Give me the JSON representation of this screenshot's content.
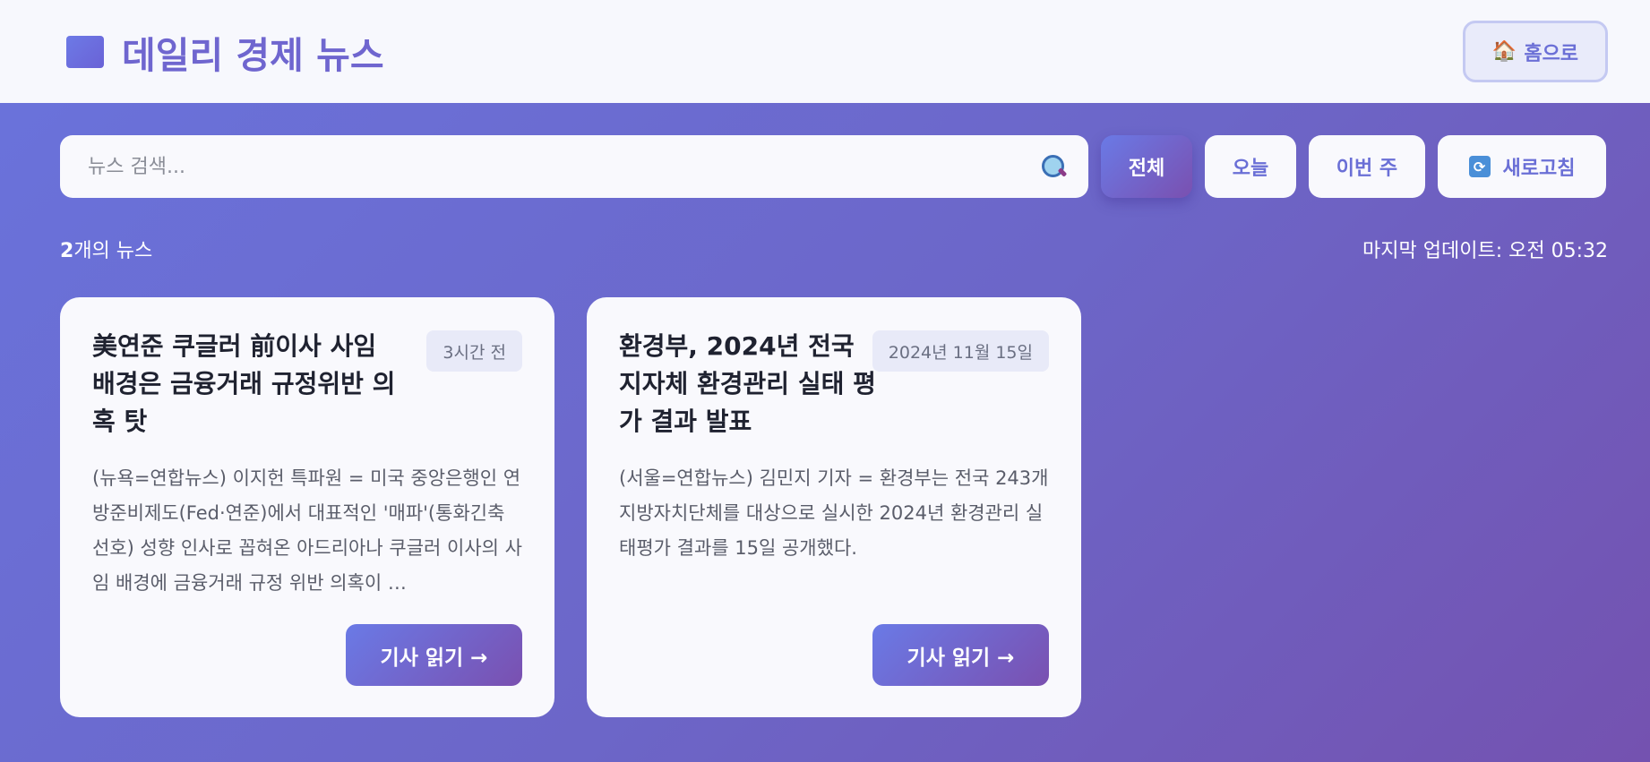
{
  "header": {
    "title": "데일리 경제 뉴스",
    "home_label": "홈으로",
    "home_emoji": "🏠"
  },
  "toolbar": {
    "search_placeholder": "뉴스 검색...",
    "filters": [
      {
        "label": "전체",
        "active": true
      },
      {
        "label": "오늘",
        "active": false
      },
      {
        "label": "이번 주",
        "active": false
      }
    ],
    "refresh_label": "새로고침",
    "refresh_icon": "🔄"
  },
  "meta": {
    "count": "2",
    "count_suffix": "개의 뉴스",
    "last_update": "마지막 업데이트: 오전 05:32"
  },
  "articles": [
    {
      "title": "美연준 쿠글러 前이사 사임 배경은 금융거래 규정위반 의혹 탓",
      "date": "3시간 전",
      "summary": "(뉴욕=연합뉴스) 이지헌 특파원 = 미국 중앙은행인 연방준비제도(Fed·연준)에서 대표적인 '매파'(통화긴축 선호) 성향 인사로 꼽혀온 아드리아나 쿠글러 이사의 사임 배경에 금융거래 규정 위반 의혹이 …",
      "read_label": "기사 읽기 →"
    },
    {
      "title": "환경부, 2024년 전국 지자체 환경관리 실태 평가 결과 발표",
      "date": "2024년 11월 15일",
      "summary": "(서울=연합뉴스) 김민지 기자 = 환경부는 전국 243개 지방자치단체를 대상으로 실시한 2024년 환경관리 실태평가 결과를 15일 공개했다.",
      "read_label": "기사 읽기 →"
    }
  ],
  "colors": {
    "accent": "#6a6fd6",
    "gradient_start": "#6a7ae6",
    "gradient_end": "#7a50b0"
  }
}
